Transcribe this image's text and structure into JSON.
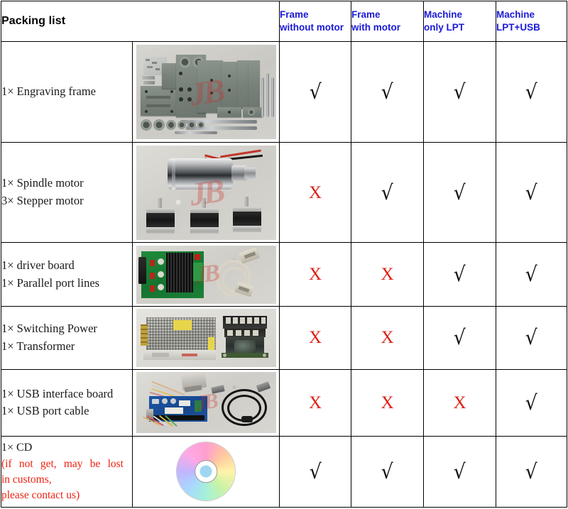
{
  "table": {
    "title": "Packing list",
    "columns": [
      {
        "id": "frame-without-motor",
        "line1": "Frame",
        "line2": "without motor"
      },
      {
        "id": "frame-with-motor",
        "line1": "Frame",
        "line2": "with motor"
      },
      {
        "id": "machine-only-lpt",
        "line1": "Machine",
        "line2": "only LPT"
      },
      {
        "id": "machine-lpt-usb",
        "line1": "Machine",
        "line2": "LPT+USB"
      }
    ],
    "rows": [
      {
        "id": "engraving-frame",
        "lines": [
          "1× Engraving frame"
        ],
        "image": "engraving-frame-photo",
        "marks": [
          "check",
          "check",
          "check",
          "check"
        ]
      },
      {
        "id": "spindle-stepper-motor",
        "lines": [
          "1× Spindle motor",
          "3× Stepper motor"
        ],
        "image": "spindle-and-stepper-motors-photo",
        "marks": [
          "cross",
          "check",
          "check",
          "check"
        ]
      },
      {
        "id": "driver-board-parallel-port",
        "lines": [
          "1× driver board",
          "1× Parallel port lines"
        ],
        "image": "driver-board-and-parallel-cable-photo",
        "marks": [
          "cross",
          "cross",
          "check",
          "check"
        ]
      },
      {
        "id": "switching-power-transformer",
        "lines": [
          "1× Switching Power",
          "1× Transformer"
        ],
        "image": "switching-power-supply-and-transformer-photo",
        "marks": [
          "cross",
          "cross",
          "check",
          "check"
        ]
      },
      {
        "id": "usb-interface-board-cable",
        "lines": [
          "1× USB interface board",
          "1× USB port cable"
        ],
        "image": "usb-interface-board-and-cable-photo",
        "marks": [
          "cross",
          "cross",
          "cross",
          "check"
        ]
      },
      {
        "id": "cd",
        "lines": [
          "1× CD"
        ],
        "note_lines": [
          "(if not get, may be lost",
          "in customs,",
          "please contact us)"
        ],
        "image": "cd-disc-photo",
        "marks": [
          "check",
          "check",
          "check",
          "check"
        ]
      }
    ],
    "glyphs": {
      "check": "√",
      "cross": "X"
    },
    "colors": {
      "header_text": "#1a1ad6",
      "note_text": "#ee2211",
      "cross": "#dd1f15",
      "check": "#111111",
      "border": "#000000",
      "background": "#ffffff"
    },
    "watermark": "JB"
  }
}
